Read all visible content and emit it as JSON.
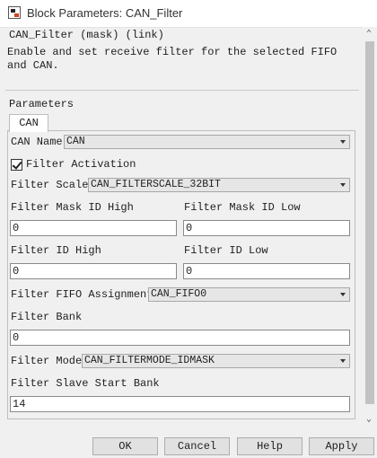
{
  "window": {
    "title": "Block Parameters: CAN_Filter"
  },
  "header": {
    "title": "CAN_Filter (mask) (link)",
    "description": "Enable and set receive filter for the selected FIFO and CAN."
  },
  "params": {
    "label": "Parameters",
    "tabs": [
      {
        "label": "CAN",
        "active": true
      }
    ],
    "can_name": {
      "label": "CAN Name",
      "value": "CAN"
    },
    "filter_activation": {
      "label": "Filter Activation",
      "checked": true
    },
    "filter_scale": {
      "label": "Filter Scale",
      "value": "CAN_FILTERSCALE_32BIT"
    },
    "mask_id_high": {
      "label": "Filter Mask ID High",
      "value": "0"
    },
    "mask_id_low": {
      "label": "Filter Mask ID Low",
      "value": "0"
    },
    "filter_id_high": {
      "label": "Filter ID High",
      "value": "0"
    },
    "filter_id_low": {
      "label": "Filter ID Low",
      "value": "0"
    },
    "fifo_assignment": {
      "label": "Filter FIFO Assignment",
      "value": "CAN_FIFO0"
    },
    "filter_bank": {
      "label": "Filter Bank",
      "value": "0"
    },
    "filter_mode": {
      "label": "Filter Mode",
      "value": "CAN_FILTERMODE_IDMASK"
    },
    "slave_start_bank": {
      "label": "Filter Slave Start Bank",
      "value": "14"
    }
  },
  "buttons": {
    "ok": "OK",
    "cancel": "Cancel",
    "help": "Help",
    "apply": "Apply"
  },
  "icons": {
    "app": "block-parameters-icon",
    "dropdown": "chevron-down-icon",
    "scroll_up": "scroll-up-icon",
    "scroll_down": "scroll-down-icon"
  },
  "colors": {
    "window_bg": "#f0f0f0",
    "field_bg": "#ffffff",
    "dropdown_bg": "#e6e6e6",
    "text": "#1e1e1e"
  }
}
